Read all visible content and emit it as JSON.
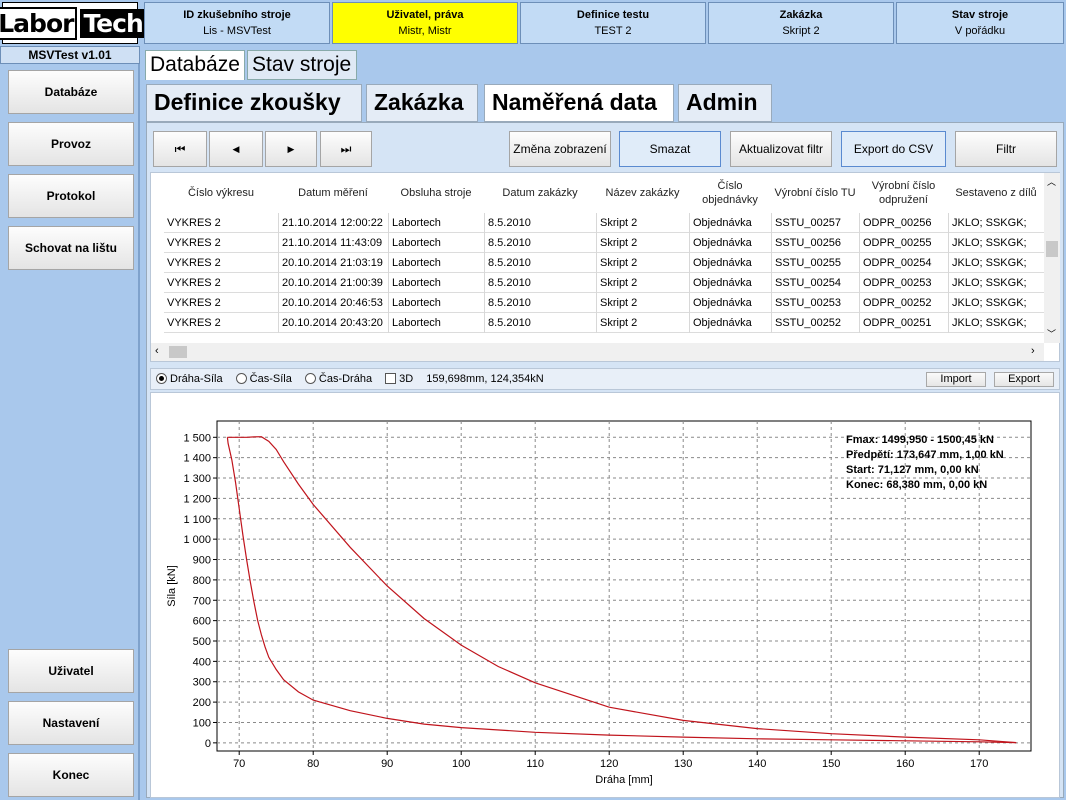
{
  "logo": {
    "part1": "Labor",
    "part2": "Tech"
  },
  "version": "MSVTest v1.01",
  "sidebar": {
    "top": [
      "Databáze",
      "Provoz",
      "Protokol",
      "Schovat na lištu"
    ],
    "bottom": [
      "Uživatel",
      "Nastavení",
      "Konec"
    ]
  },
  "header": [
    {
      "title": "ID zkušebního stroje",
      "value": "Lis - MSVTest"
    },
    {
      "title": "Uživatel, práva",
      "value": "Mistr, Mistr"
    },
    {
      "title": "Definice testu",
      "value": "TEST 2"
    },
    {
      "title": "Zakázka",
      "value": "Skript 2"
    },
    {
      "title": "Stav stroje",
      "value": "V pořádku"
    }
  ],
  "tabs_main": [
    "Databáze",
    "Stav stroje"
  ],
  "tabs_sub": [
    "Definice zkoušky",
    "Zakázka",
    "Naměřená data",
    "Admin"
  ],
  "nav": {
    "first": "⏮",
    "prev": "◀",
    "next": "▶",
    "last": "⏭"
  },
  "actions": [
    "Změna zobrazení",
    "Smazat",
    "Aktualizovat filtr",
    "Export do CSV",
    "Filtr"
  ],
  "table": {
    "columns": [
      "Číslo výkresu",
      "Datum měření",
      "Obsluha stroje",
      "Datum zakázky",
      "Název zakázky",
      "Číslo objednávky",
      "Výrobní číslo TU",
      "Výrobní číslo odpružení",
      "Sestaveno z dílů"
    ],
    "rows": [
      [
        "VYKRES 2",
        "21.10.2014 12:00:22",
        "Labortech",
        "8.5.2010",
        "Skript 2",
        "Objednávka",
        "SSTU_00257",
        "ODPR_00256",
        "JKLO; SSKGK;"
      ],
      [
        "VYKRES 2",
        "21.10.2014 11:43:09",
        "Labortech",
        "8.5.2010",
        "Skript 2",
        "Objednávka",
        "SSTU_00256",
        "ODPR_00255",
        "JKLO; SSKGK;"
      ],
      [
        "VYKRES 2",
        "20.10.2014 21:03:19",
        "Labortech",
        "8.5.2010",
        "Skript 2",
        "Objednávka",
        "SSTU_00255",
        "ODPR_00254",
        "JKLO; SSKGK;"
      ],
      [
        "VYKRES 2",
        "20.10.2014 21:00:39",
        "Labortech",
        "8.5.2010",
        "Skript 2",
        "Objednávka",
        "SSTU_00254",
        "ODPR_00253",
        "JKLO; SSKGK;"
      ],
      [
        "VYKRES 2",
        "20.10.2014 20:46:53",
        "Labortech",
        "8.5.2010",
        "Skript 2",
        "Objednávka",
        "SSTU_00253",
        "ODPR_00252",
        "JKLO; SSKGK;"
      ],
      [
        "VYKRES 2",
        "20.10.2014 20:43:20",
        "Labortech",
        "8.5.2010",
        "Skript 2",
        "Objednávka",
        "SSTU_00252",
        "ODPR_00251",
        "JKLO; SSKGK;"
      ]
    ]
  },
  "chart_controls": {
    "radio1": "Dráha-Síla",
    "radio2": "Čas-Síla",
    "radio3": "Čas-Dráha",
    "check3d": "3D",
    "cursor": "159,698mm, 124,354kN",
    "import": "Import",
    "export": "Export"
  },
  "chart_data": {
    "type": "line",
    "xlabel": "Dráha [mm]",
    "ylabel": "Síla [kN]",
    "xlim": [
      67,
      177
    ],
    "ylim": [
      -40,
      1580
    ],
    "xticks": [
      70,
      80,
      90,
      100,
      110,
      120,
      130,
      140,
      150,
      160,
      170
    ],
    "yticks": [
      0,
      100,
      200,
      300,
      400,
      500,
      600,
      700,
      800,
      900,
      1000,
      1100,
      1200,
      1300,
      1400,
      1500
    ],
    "ytick_labels": [
      "0",
      "100",
      "200",
      "300",
      "400",
      "500",
      "600",
      "700",
      "800",
      "900",
      "1 000",
      "1 100",
      "1 200",
      "1 300",
      "1 400",
      "1 500"
    ],
    "grid": true,
    "line_color": "#c0141c",
    "annotations": [
      "Fmax: 1499,950 - 1500,45 kN",
      "Předpětí: 173,647 mm, 1,00 kN",
      "Start: 71,127 mm, 0,00 kN",
      "Konec: 68,380 mm, 0,00 kN"
    ],
    "series": [
      {
        "x": [
          175,
          170,
          160,
          150,
          140,
          130,
          120,
          110,
          100,
          95,
          90,
          85,
          80,
          78,
          76,
          75,
          74,
          73.5,
          73,
          72.5,
          72,
          71.5,
          71,
          70.5,
          70,
          69.5,
          69,
          68.5,
          68.4
        ],
        "y": [
          1,
          5,
          10,
          15,
          20,
          28,
          38,
          52,
          75,
          92,
          120,
          158,
          210,
          250,
          310,
          360,
          420,
          470,
          530,
          600,
          690,
          790,
          900,
          1020,
          1150,
          1280,
          1390,
          1470,
          1500
        ]
      },
      {
        "x": [
          68.4,
          69,
          70,
          71,
          72,
          73,
          74,
          75,
          76,
          78,
          80,
          85,
          90,
          95,
          100,
          105,
          110,
          120,
          130,
          140,
          150,
          160,
          170,
          173.6,
          175
        ],
        "y": [
          1500,
          1500,
          1500,
          1500,
          1502,
          1503,
          1480,
          1440,
          1380,
          1270,
          1170,
          960,
          770,
          610,
          480,
          375,
          295,
          175,
          110,
          70,
          45,
          28,
          15,
          5,
          1
        ]
      }
    ]
  }
}
